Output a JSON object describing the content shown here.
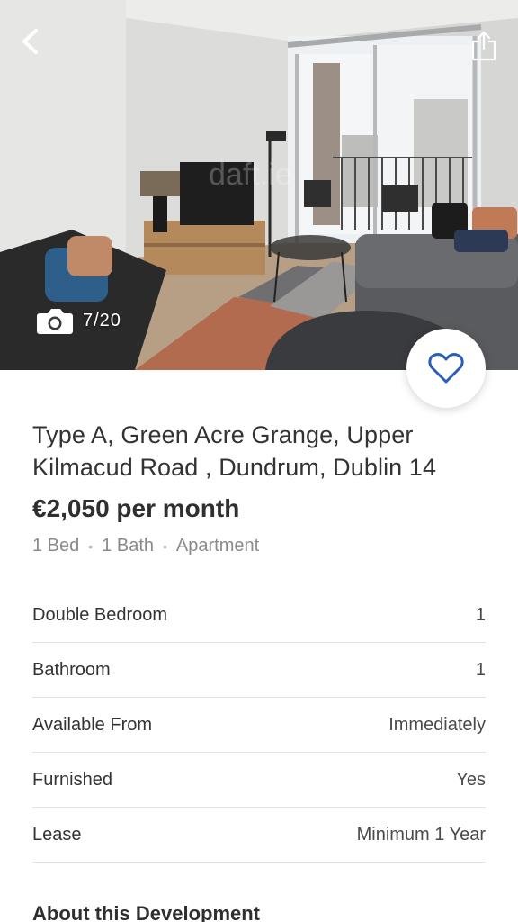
{
  "gallery": {
    "counter": "7/20",
    "watermark": "daft.ie"
  },
  "listing": {
    "title": "Type A, Green Acre Grange, Upper Kilmacud Road , Dundrum, Dublin 14",
    "price": "€2,050 per month",
    "meta": [
      "1 Bed",
      "1 Bath",
      "Apartment"
    ]
  },
  "details": [
    {
      "label": "Double Bedroom",
      "value": "1"
    },
    {
      "label": "Bathroom",
      "value": "1"
    },
    {
      "label": "Available From",
      "value": "Immediately"
    },
    {
      "label": "Furnished",
      "value": "Yes"
    },
    {
      "label": "Lease",
      "value": "Minimum 1 Year"
    }
  ],
  "sections": {
    "about_title": "About this Development"
  },
  "icons": {
    "back": "chevron-left-icon",
    "share": "share-icon",
    "camera": "camera-icon",
    "favorite": "heart-outline-icon"
  },
  "colors": {
    "accent": "#2b5fb4"
  }
}
